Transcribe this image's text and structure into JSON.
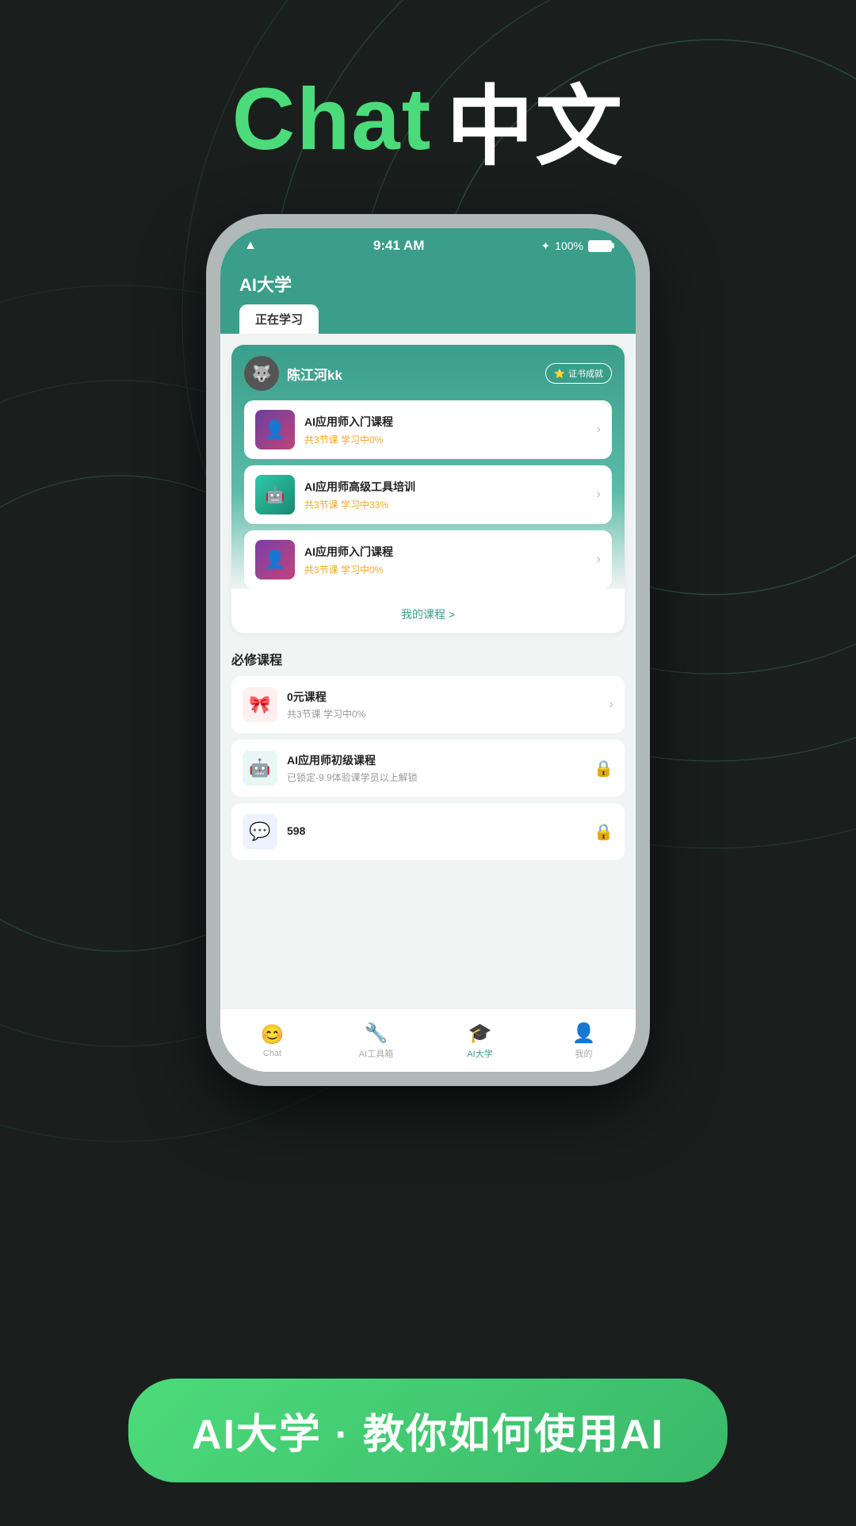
{
  "background": {
    "color": "#1a1f1e"
  },
  "header": {
    "chat_label": "Chat",
    "chinese_label": "中文"
  },
  "status_bar": {
    "time": "9:41 AM",
    "battery_percent": "100%"
  },
  "app": {
    "title": "AI大学",
    "active_tab": "正在学习"
  },
  "learning_card": {
    "user": {
      "name": "陈江河kk",
      "avatar_emoji": "🐺"
    },
    "cert_badge": "证书成就",
    "courses": [
      {
        "name": "AI应用师入门课程",
        "meta": "共3节课   学习中0%",
        "thumb_type": "1"
      },
      {
        "name": "AI应用师高级工具培训",
        "meta": "共3节课   学习中33%",
        "thumb_type": "2"
      },
      {
        "name": "AI应用师入门课程",
        "meta": "共3节课   学习中0%",
        "thumb_type": "3"
      }
    ],
    "my_courses_link": "我的课程 >"
  },
  "required_section": {
    "title": "必修课程",
    "items": [
      {
        "name": "0元课程",
        "sub": "共3节课  学习中0%",
        "icon_color": "#f55a5a",
        "icon_emoji": "🎁",
        "action": "chevron",
        "locked": false
      },
      {
        "name": "AI应用师初级课程",
        "sub": "已锁定-9.9体验课学员以上解锁",
        "icon_color": "#3a9e8a",
        "icon_emoji": "🤖",
        "action": "lock",
        "locked": true
      },
      {
        "name": "598",
        "sub": "",
        "icon_color": "#5b8fef",
        "icon_emoji": "💬",
        "action": "lock",
        "locked": true
      }
    ]
  },
  "bottom_nav": {
    "items": [
      {
        "label": "Chat",
        "icon": "😊",
        "active": false
      },
      {
        "label": "AI工具箱",
        "icon": "🔧",
        "active": false
      },
      {
        "label": "AI大学",
        "icon": "🎓",
        "active": true
      },
      {
        "label": "我的",
        "icon": "👤",
        "active": false
      }
    ]
  },
  "bottom_cta": {
    "text": "AI大学 · 教你如何使用AI"
  }
}
